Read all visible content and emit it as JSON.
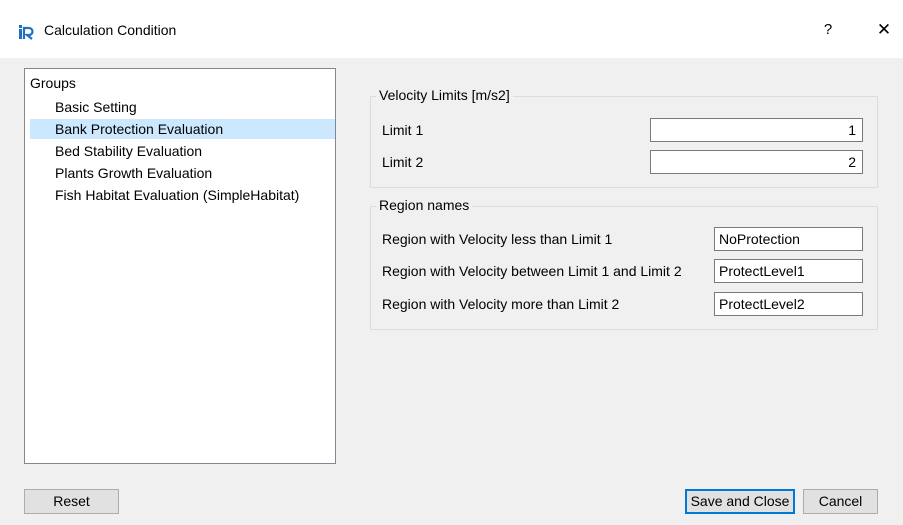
{
  "window": {
    "title": "Calculation Condition",
    "help_label": "?",
    "close_label": "✕"
  },
  "tree": {
    "root_label": "Groups",
    "items": [
      {
        "label": "Basic Setting",
        "selected": false
      },
      {
        "label": "Bank Protection Evaluation",
        "selected": true
      },
      {
        "label": "Bed Stability Evaluation",
        "selected": false
      },
      {
        "label": "Plants Growth Evaluation",
        "selected": false
      },
      {
        "label": "Fish Habitat Evaluation (SimpleHabitat)",
        "selected": false
      }
    ]
  },
  "velocity_limits": {
    "title": "Velocity Limits [m/s2]",
    "limit1_label": "Limit 1",
    "limit1_value": "1",
    "limit2_label": "Limit 2",
    "limit2_value": "2"
  },
  "region_names": {
    "title": "Region names",
    "less_label": "Region with Velocity less than Limit 1",
    "less_value": "NoProtection",
    "between_label": "Region with Velocity between Limit 1 and Limit 2",
    "between_value": "ProtectLevel1",
    "more_label": "Region with Velocity more than Limit 2",
    "more_value": "ProtectLevel2"
  },
  "buttons": {
    "reset": "Reset",
    "save_close": "Save and Close",
    "cancel": "Cancel"
  },
  "colors": {
    "accent": "#0078d7",
    "selection": "#cce8ff",
    "window_bg": "#f0f0f0"
  }
}
